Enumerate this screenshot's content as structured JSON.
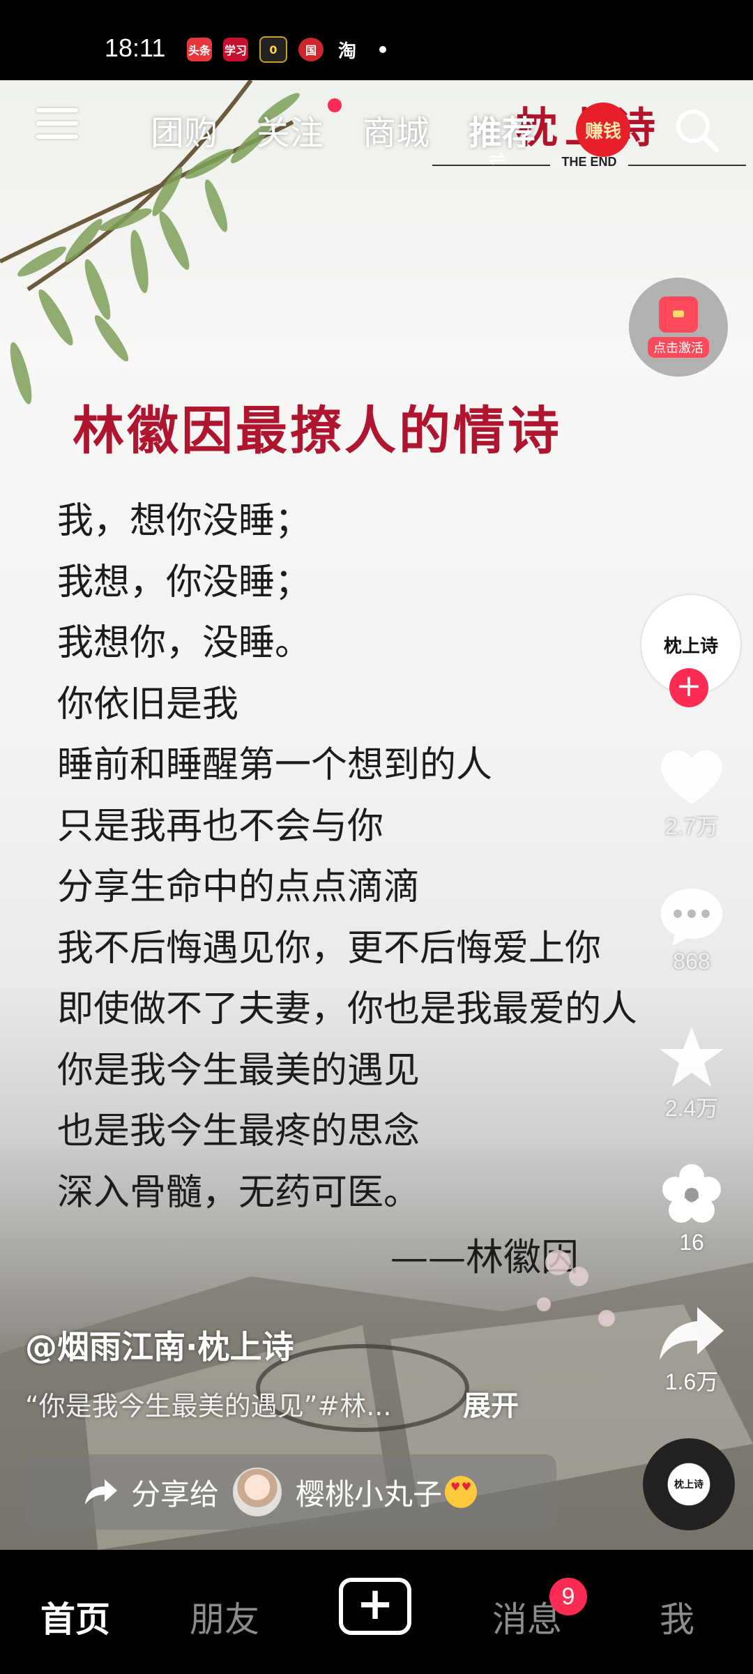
{
  "status_bar": {
    "time": "18:11",
    "app_icons": [
      {
        "name": "toutiao",
        "label": "头条",
        "color": "#e8383d"
      },
      {
        "name": "xuexi",
        "label": "学习",
        "color": "#c8102e"
      },
      {
        "name": "dark-app",
        "label": "0",
        "color": "#222222"
      },
      {
        "name": "gov-app",
        "label": "国",
        "color": "#d1252d"
      },
      {
        "name": "taobao",
        "label": "淘",
        "color": "#000000"
      }
    ]
  },
  "top_nav": {
    "tabs": [
      {
        "label": "团购",
        "active": false
      },
      {
        "label": "关注",
        "active": false,
        "has_dot": true
      },
      {
        "label": "商城",
        "active": false
      },
      {
        "label": "推荐",
        "active": true
      }
    ],
    "earn_label": "赚钱"
  },
  "video": {
    "brand_title": "枕上诗",
    "brand_sub": "THE END",
    "redpacket_label": "点击激活",
    "poem_title": "林徽因最撩人的情诗",
    "poem_lines": [
      "我，想你没睡；",
      "我想，你没睡；",
      "我想你，没睡。",
      "你依旧是我",
      "睡前和睡醒第一个想到的人",
      "只是我再也不会与你",
      "分享生命中的点点滴滴",
      "我不后悔遇见你，更不后悔爱上你",
      "即使做不了夫妻，你也是我最爱的人",
      "你是我今生最美的遇见",
      "也是我今生最疼的思念",
      "深入骨髓，无药可医。"
    ],
    "poem_author": "——林徽因"
  },
  "side_actions": {
    "avatar_text": "枕上诗",
    "likes": "2.7万",
    "comments": "868",
    "favorites": "2.4万",
    "flower": "16",
    "shares": "1.6万"
  },
  "post": {
    "author": "@烟雨江南·枕上诗",
    "description": "“你是我今生最美的遇见”#林...",
    "expand_label": "展开",
    "share_label": "分享给",
    "share_friend": "樱桃小丸子",
    "music_disc_text": "枕上诗"
  },
  "bottom_nav": {
    "home": "首页",
    "friends": "朋友",
    "messages": "消息",
    "messages_badge": "9",
    "me": "我"
  },
  "colors": {
    "accent": "#fe2c55",
    "poem_title": "#b01530",
    "brand": "#b3142a"
  }
}
